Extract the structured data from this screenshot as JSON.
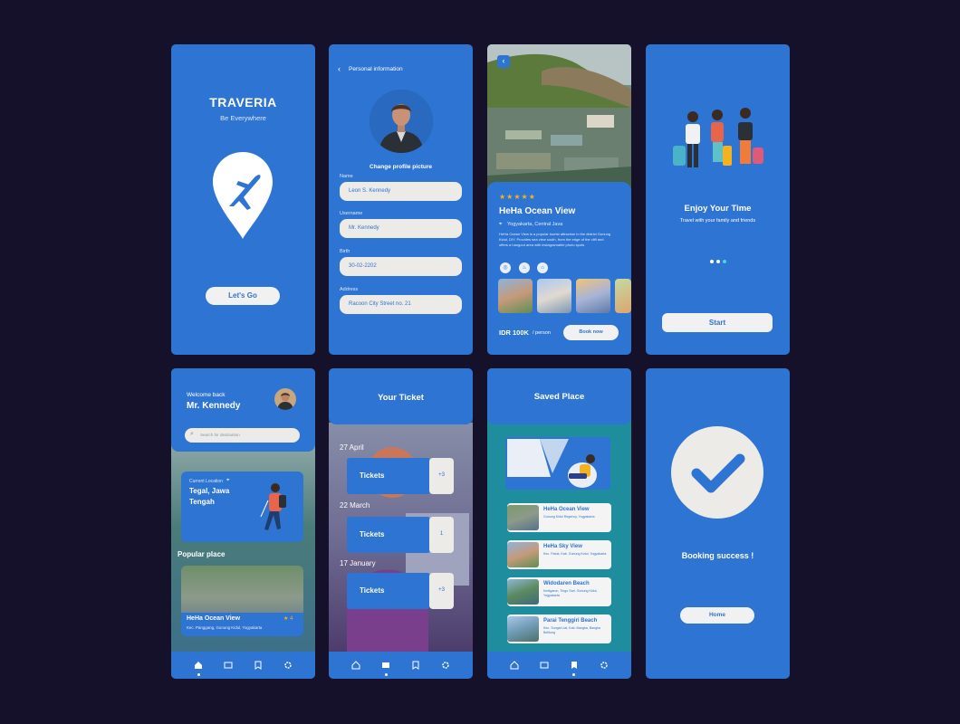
{
  "splash": {
    "title": "TRAVERIA",
    "tagline": "Be Everywhere",
    "cta": "Let's Go"
  },
  "profile": {
    "header": "Personal information",
    "change_picture": "Change profile picture",
    "fields": [
      {
        "label": "Name",
        "value": "Leon S. Kennedy"
      },
      {
        "label": "Username",
        "value": "Mr. Kennedy"
      },
      {
        "label": "Birth",
        "value": "30-02-2202"
      },
      {
        "label": "Address",
        "value": "Racoon City Street no. 21"
      }
    ]
  },
  "detail": {
    "stars": "★★★★★",
    "title": "HeHa Ocean View",
    "location": "Yogyakarta, Central Java",
    "description": "HeHa Ocean View is a popular tourist attraction in the district Gunung Kidul, DIY. Provides sea view south, from the edge of the cliff and offers a hangout area with instagramable photo spots",
    "price": "IDR 100K",
    "price_unit": "/ person",
    "book": "Book now"
  },
  "onboarding": {
    "title": "Enjoy Your Time",
    "subtitle": "Travel with your family and friends",
    "cta": "Start"
  },
  "home": {
    "welcome": "Welcome back",
    "user": "Mr. Kennedy",
    "search_placeholder": "Search for destination",
    "current_label": "Current Location",
    "current_city": "Tegal, Jawa Tengah",
    "popular": "Popular place",
    "card_title": "HeHa Ocean View",
    "card_rating": "★ 4",
    "card_address": "Kec. Panggang, Gunung Kidul, Yogyakarta"
  },
  "tickets": {
    "title": "Your Ticket",
    "groups": [
      {
        "date": "27 April",
        "label": "Tickets",
        "count": "+3"
      },
      {
        "date": "22 March",
        "label": "Tickets",
        "count": "1"
      },
      {
        "date": "17 January",
        "label": "Tickets",
        "count": "+3"
      }
    ]
  },
  "saved": {
    "title": "Saved Place",
    "items": [
      {
        "name": "HeHa Ocean View",
        "address": "Gunung Kidul Regency, Yogyakarta"
      },
      {
        "name": "HeHa Sky View",
        "address": "Kec. Patuk, Kab. Gunung Kidul, Yogyakarta"
      },
      {
        "name": "Widodaren Beach",
        "address": "Kedigaron, Tlogo Sari, Gunung Kidul, Yogyakarta"
      },
      {
        "name": "Parai Tenggiri Beach",
        "address": "Kec. Sungai Liat, Kab. Bangka, Bangka Belitung"
      }
    ]
  },
  "success": {
    "message": "Booking success !",
    "home": "Home"
  },
  "colors": {
    "brand": "#2e74d2",
    "background": "#15112b",
    "accent": "#f4b31e"
  }
}
